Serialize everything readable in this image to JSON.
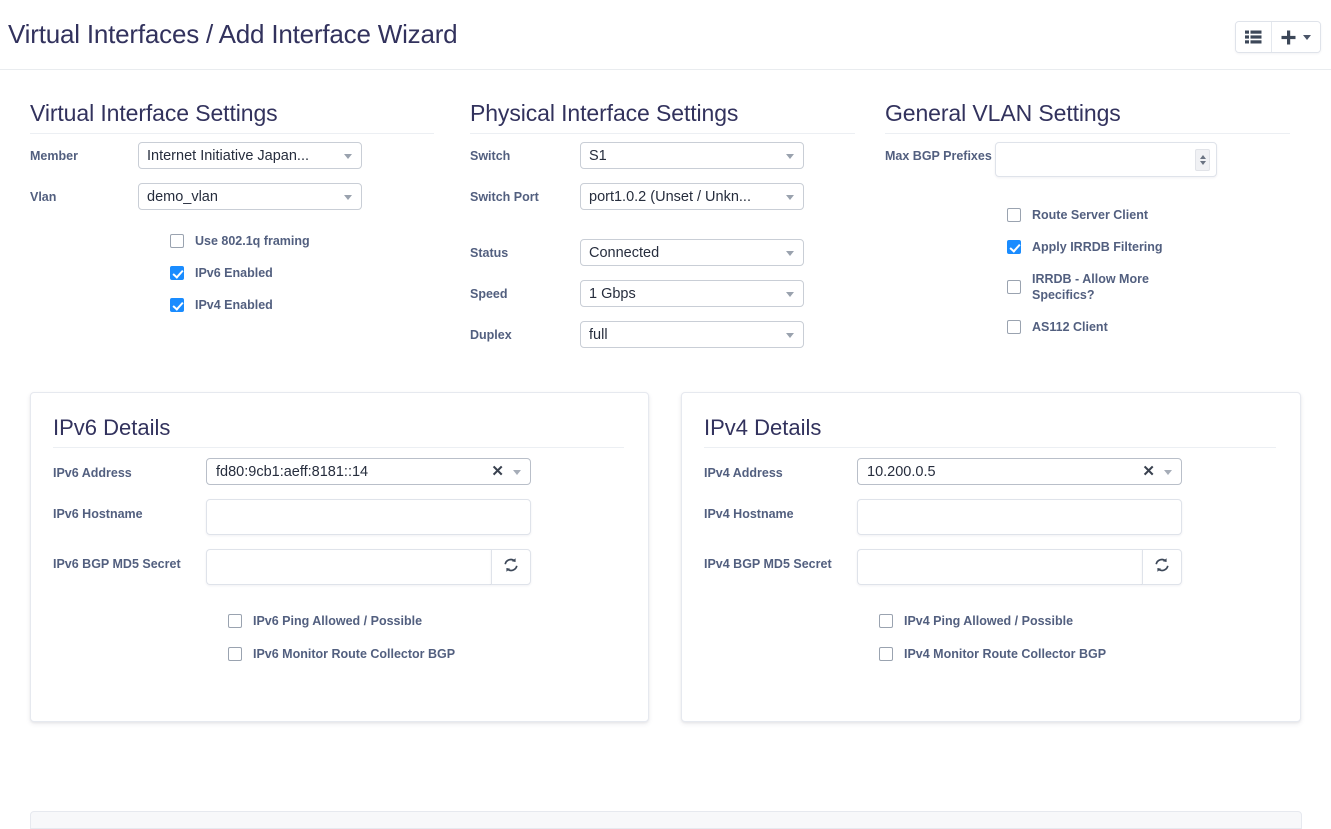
{
  "header": {
    "title": "Virtual Interfaces / Add Interface Wizard",
    "list_view_icon": "list-view-icon",
    "add_icon": "plus-icon",
    "add_dropdown_icon": "chevron-down-icon"
  },
  "virtual_interface_settings": {
    "heading": "Virtual Interface Settings",
    "member": {
      "label": "Member",
      "value": "Internet Initiative Japan..."
    },
    "vlan": {
      "label": "Vlan",
      "value": "demo_vlan"
    },
    "checkboxes": [
      {
        "label": "Use 802.1q framing",
        "checked": false
      },
      {
        "label": "IPv6 Enabled",
        "checked": true
      },
      {
        "label": "IPv4 Enabled",
        "checked": true
      }
    ]
  },
  "physical_interface_settings": {
    "heading": "Physical Interface Settings",
    "fields": [
      {
        "label": "Switch",
        "value": "S1"
      },
      {
        "label": "Switch Port",
        "value": "port1.0.2 (Unset / Unkn..."
      },
      {
        "label": "Status",
        "value": "Connected"
      },
      {
        "label": "Speed",
        "value": "1 Gbps"
      },
      {
        "label": "Duplex",
        "value": "full"
      }
    ]
  },
  "general_vlan_settings": {
    "heading": "General VLAN Settings",
    "max_bgp_prefixes": {
      "label": "Max BGP Prefixes",
      "value": "",
      "placeholder": ""
    },
    "checkboxes": [
      {
        "label": "Route Server Client",
        "checked": false
      },
      {
        "label": "Apply IRRDB Filtering",
        "checked": true
      },
      {
        "label": "IRRDB - Allow More Specifics?",
        "checked": false
      },
      {
        "label": "AS112 Client",
        "checked": false
      }
    ]
  },
  "ipv6_details": {
    "title": "IPv6 Details",
    "address": {
      "label": "IPv6 Address",
      "value": "fd80:9cb1:aeff:8181::14",
      "clear_icon": "clear-icon"
    },
    "hostname": {
      "label": "IPv6 Hostname",
      "value": "",
      "placeholder": ""
    },
    "md5_secret": {
      "label": "IPv6 BGP MD5 Secret",
      "value": "",
      "placeholder": "",
      "generate_icon": "refresh-icon"
    },
    "checkboxes": [
      {
        "label": "IPv6 Ping Allowed / Possible",
        "checked": false
      },
      {
        "label": "IPv6 Monitor Route Collector BGP",
        "checked": false
      }
    ]
  },
  "ipv4_details": {
    "title": "IPv4 Details",
    "address": {
      "label": "IPv4 Address",
      "value": "10.200.0.5",
      "clear_icon": "clear-icon"
    },
    "hostname": {
      "label": "IPv4 Hostname",
      "value": "",
      "placeholder": ""
    },
    "md5_secret": {
      "label": "IPv4 BGP MD5 Secret",
      "value": "",
      "placeholder": "",
      "generate_icon": "refresh-icon"
    },
    "checkboxes": [
      {
        "label": "IPv4 Ping Allowed / Possible",
        "checked": false
      },
      {
        "label": "IPv4 Monitor Route Collector BGP",
        "checked": false
      }
    ]
  },
  "colors": {
    "accent": "#1a8cff",
    "title": "#32325d",
    "label": "#525f7f",
    "border": "#dfe3ea"
  }
}
